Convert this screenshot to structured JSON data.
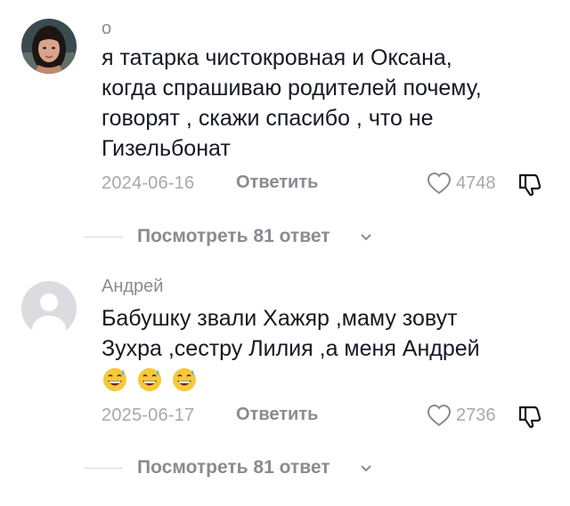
{
  "comments": [
    {
      "username": "о",
      "text_lines": [
        "я татарка чистокровная и Оксана,",
        "когда спрашиваю родителей почему,",
        "говорят , скажи спасибо , что не",
        "Гизельбонат"
      ],
      "date": "2024-06-16",
      "reply_label": "Ответить",
      "likes": "4748",
      "view_replies": "Посмотреть 81 ответ"
    },
    {
      "username": "Андрей",
      "text_lines": [
        "Бабушку звали Хажяр ,маму зовут",
        "Зухра ,сестру Лилия ,а меня Андрей"
      ],
      "emoji": [
        "😅",
        "😅",
        "😅"
      ],
      "date": "2025-06-17",
      "reply_label": "Ответить",
      "likes": "2736",
      "view_replies": "Посмотреть 81 ответ"
    }
  ],
  "icons": {
    "like": "heart-outline-icon",
    "dislike": "thumbs-down-icon",
    "expand": "chevron-down-icon",
    "emoji": "grinning-face-with-sweat-emoji"
  },
  "colors": {
    "text": "#161823",
    "secondary": "#8a8b91",
    "date": "#a7a8ac"
  }
}
